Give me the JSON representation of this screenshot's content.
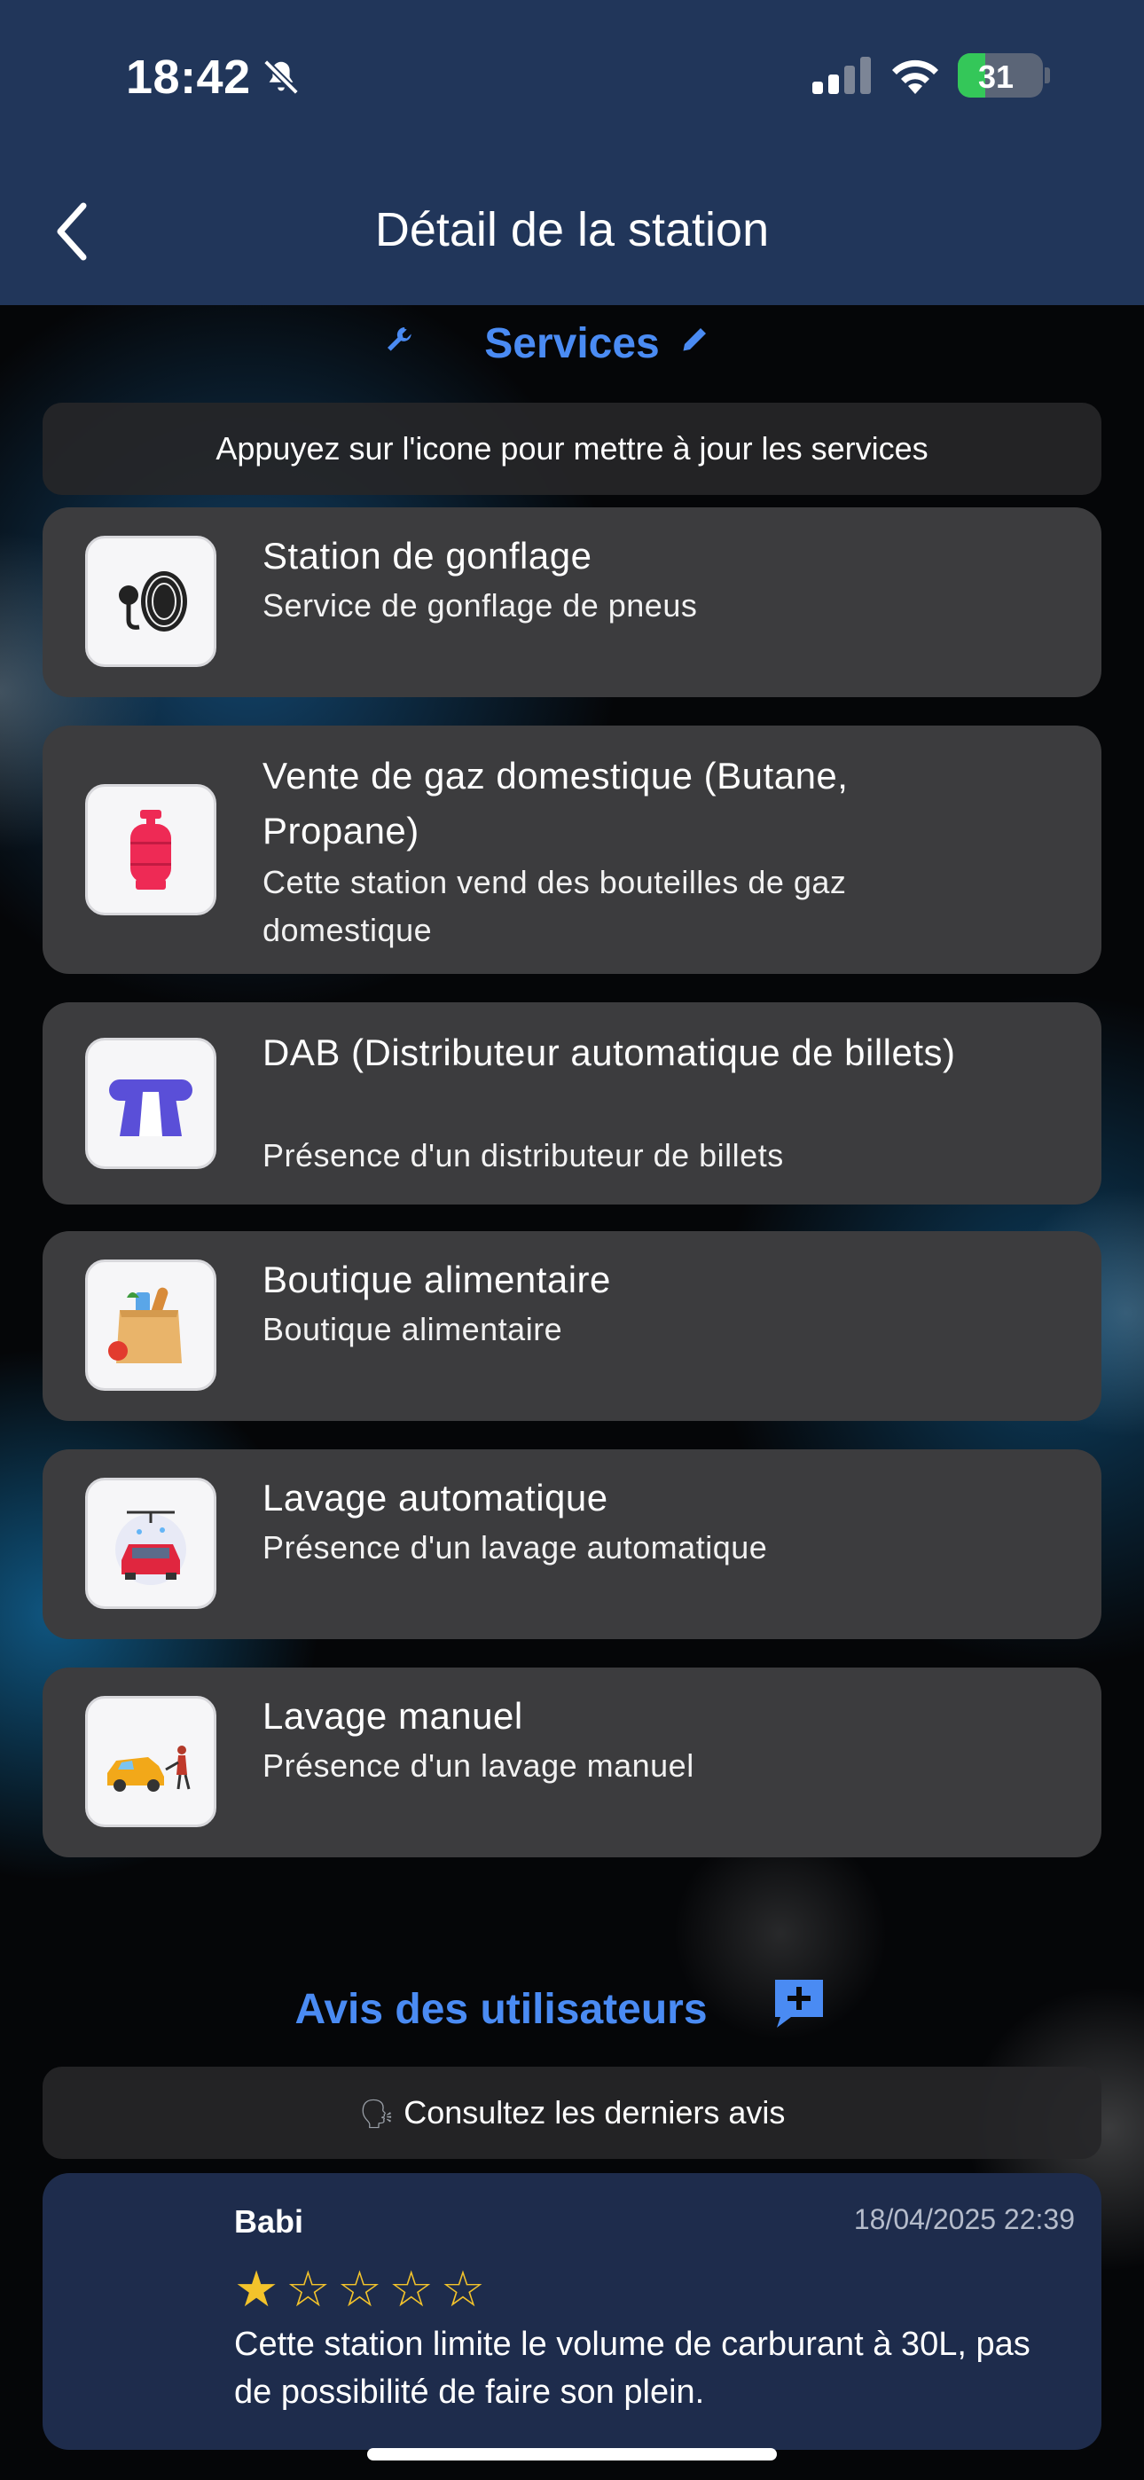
{
  "status_bar": {
    "time": "18:42",
    "battery": "31"
  },
  "header": {
    "title": "Détail de la station"
  },
  "services": {
    "title": "Services",
    "hint": "Appuyez sur l'icone pour mettre à jour les services",
    "items": [
      {
        "title": "Station de gonflage",
        "subtitle": "Service de gonflage de pneus",
        "icon": "tire-inflation-icon"
      },
      {
        "title": "Vente de gaz domestique (Butane, Propane)",
        "subtitle": "Cette station vend des bouteilles de gaz domestique",
        "icon": "gas-cylinder-icon"
      },
      {
        "title": "DAB (Distributeur automatique de billets)",
        "subtitle": "Présence d'un distributeur de billets",
        "icon": "atm-icon"
      },
      {
        "title": "Boutique alimentaire",
        "subtitle": "Boutique alimentaire",
        "icon": "grocery-bag-icon"
      },
      {
        "title": "Lavage automatique",
        "subtitle": "Présence d'un lavage automatique",
        "icon": "car-wash-icon"
      },
      {
        "title": "Lavage manuel",
        "subtitle": "Présence d'un lavage manuel",
        "icon": "manual-wash-icon"
      }
    ]
  },
  "reviews": {
    "title": "Avis des utilisateurs",
    "hint": "Consultez les derniers avis",
    "items": [
      {
        "author": "Babi",
        "date": "18/04/2025 22:39",
        "rating": 1,
        "max_rating": 5,
        "stars": "★☆☆☆☆",
        "text": "Cette station limite le volume de carburant à 30L, pas de possibilité de faire son plein."
      }
    ]
  },
  "colors": {
    "header": "#21365a",
    "accent": "#4a8bf3",
    "card": "#3c3c3e",
    "review_card": "#1e2c4c",
    "star": "#f3c32b"
  }
}
